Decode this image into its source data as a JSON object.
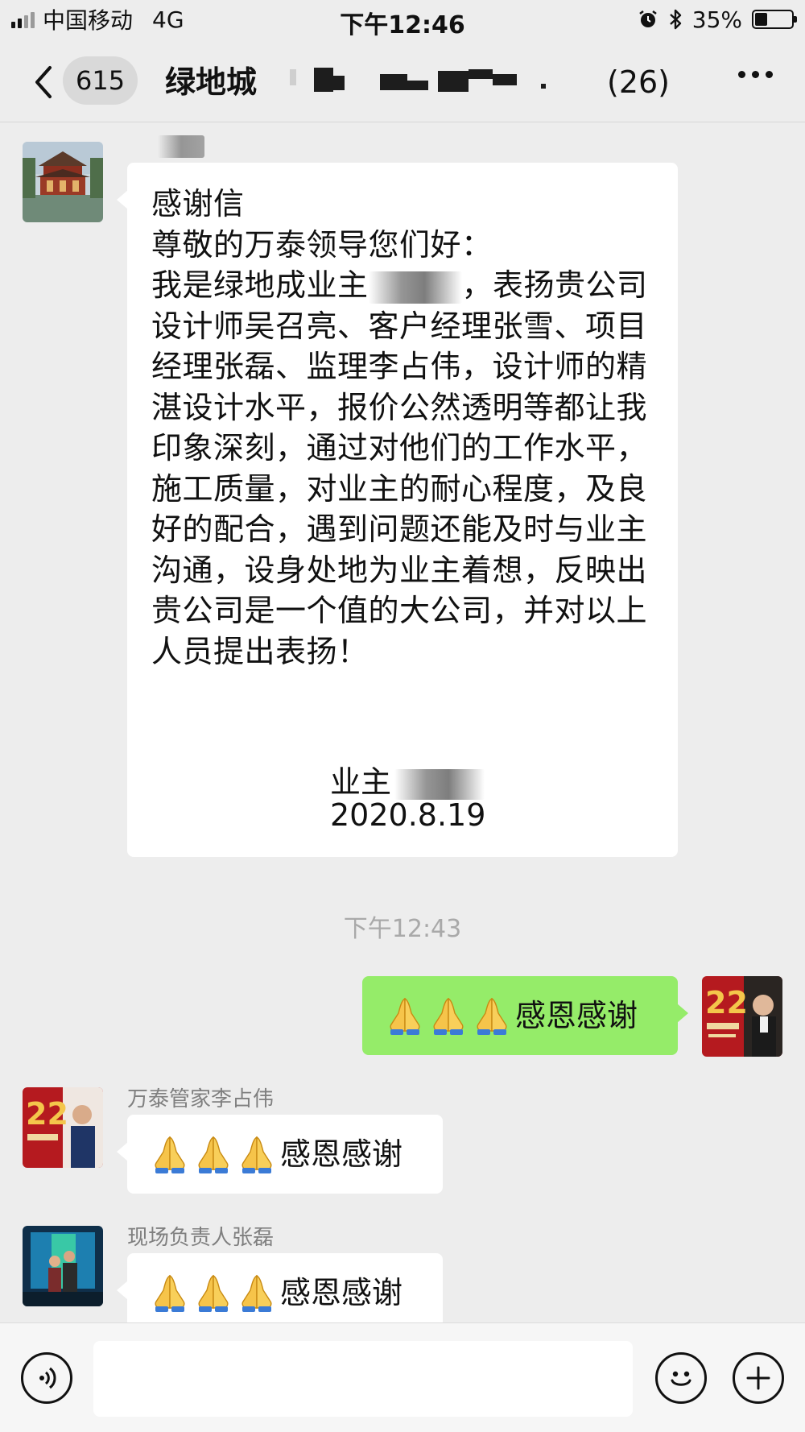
{
  "status_bar": {
    "carrier": "中国移动",
    "network": "4G",
    "time": "下午12:46",
    "battery_percent": "35%",
    "battery_level": 0.35
  },
  "nav": {
    "unread_count": "615",
    "title": "绿地城",
    "member_count": "(26)",
    "icons": [
      "back-icon",
      "more-icon"
    ]
  },
  "messages": {
    "letter": {
      "title": "感谢信",
      "greeting": "尊敬的万泰领导您们好：",
      "body_before_redaction": "我是绿地成业主",
      "body_after_redaction": "，表扬贵公司设计师吴召亮、客户经理张雪、项目经理张磊、监理李占伟，设计师的精湛设计水平，报价公然透明等都让我印象深刻，通过对他们的工作水平，施工质量，对业主的耐心程度，及良好的配合，遇到问题还能及时与业主沟通，设身处地为业主着想，反映出贵公司是一个值的大公司，并对以上人员提出表扬！",
      "signature_label": "业主",
      "date": "2020.8.19"
    },
    "time_separator": "下午12:43",
    "outgoing": {
      "emoji": "🙏🙏🙏",
      "text": "感恩感谢"
    },
    "incoming": [
      {
        "sender": "万泰管家李占伟",
        "emoji": "🙏🙏🙏",
        "text": "感恩感谢"
      },
      {
        "sender": "现场负责人张磊",
        "emoji": "🙏🙏🙏",
        "text": "感恩感谢"
      }
    ]
  },
  "input_bar": {
    "icons": [
      "voice-icon",
      "emoji-icon",
      "plus-icon"
    ]
  }
}
